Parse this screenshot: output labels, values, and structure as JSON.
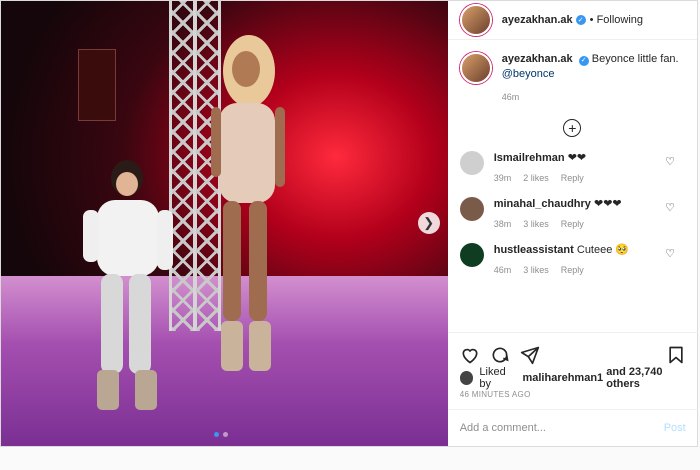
{
  "post": {
    "username": "ayezakhan.ak",
    "follow_label": "Following",
    "caption_text": "Beyonce little fan.",
    "caption_mention": "@beyonce",
    "caption_time": "46m",
    "likes_prefix": "Liked by",
    "likes_user": "maliharehman1",
    "likes_suffix": "and 23,740 others",
    "ago": "46 MINUTES AGO",
    "add_comment_placeholder": "Add a comment...",
    "post_label": "Post"
  },
  "comments": [
    {
      "user": "Ismailrehman",
      "text": "❤❤",
      "time": "39m",
      "likes": "2 likes",
      "reply": "Reply",
      "avatar_color": "#cfcfcf"
    },
    {
      "user": "minahal_chaudhry",
      "text": "❤❤❤",
      "time": "38m",
      "likes": "3 likes",
      "reply": "Reply",
      "avatar_color": "#7a5b4a"
    },
    {
      "user": "hustleassistant",
      "text": "Cuteee 🥺",
      "time": "46m",
      "likes": "3 likes",
      "reply": "Reply",
      "avatar_color": "#0f3d22"
    }
  ],
  "icons": {
    "verified": "verified-icon",
    "plus": "plus-circle-icon",
    "heart": "heart-icon",
    "comment": "comment-icon",
    "share": "share-icon",
    "save": "bookmark-icon",
    "next": "chevron-right-icon"
  }
}
